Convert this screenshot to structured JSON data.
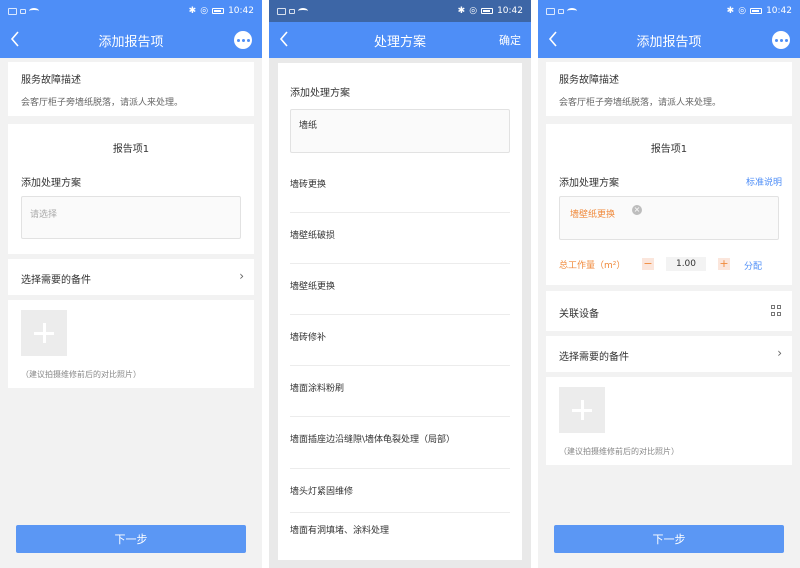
{
  "status": {
    "time": "10:42"
  },
  "screen1": {
    "title": "添加报告项",
    "fault_title": "服务故障描述",
    "fault_desc": "会客厅柜子旁墙纸脱落，请派人来处理。",
    "item_title": "报告项1",
    "plan_label": "添加处理方案",
    "plan_placeholder": "请选择",
    "parts_label": "选择需要的备件",
    "photo_hint": "（建议拍摄维修前后的对比照片）",
    "next_label": "下一步"
  },
  "screen2": {
    "title": "处理方案",
    "confirm_label": "确定",
    "add_label": "添加处理方案",
    "input_value": "墙纸",
    "options": [
      "墙砖更换",
      "墙壁纸破损",
      "墙壁纸更换",
      "墙砖修补",
      "墙面涂料粉刷",
      "墙面插座边沿缝隙\\墙体龟裂处理（局部）",
      "墙头灯紧固维修",
      "墙面有洞填堵、涂料处理"
    ]
  },
  "screen3": {
    "title": "添加报告项",
    "fault_title": "服务故障描述",
    "fault_desc": "会客厅柜子旁墙纸脱落，请派人来处理。",
    "item_title": "报告项1",
    "plan_label": "添加处理方案",
    "standard_link": "标准说明",
    "selected_tag": "墙壁纸更换",
    "workload_label": "总工作量（m²）",
    "workload_value": "1.00",
    "minus": "−",
    "plus": "+",
    "assign_link": "分配",
    "device_label": "关联设备",
    "parts_label": "选择需要的备件",
    "photo_hint": "（建议拍摄维修前后的对比照片）",
    "next_label": "下一步"
  },
  "colors": {
    "primary": "#4e8ef7",
    "accent": "#f08a3c",
    "background": "#f2f2f2"
  }
}
